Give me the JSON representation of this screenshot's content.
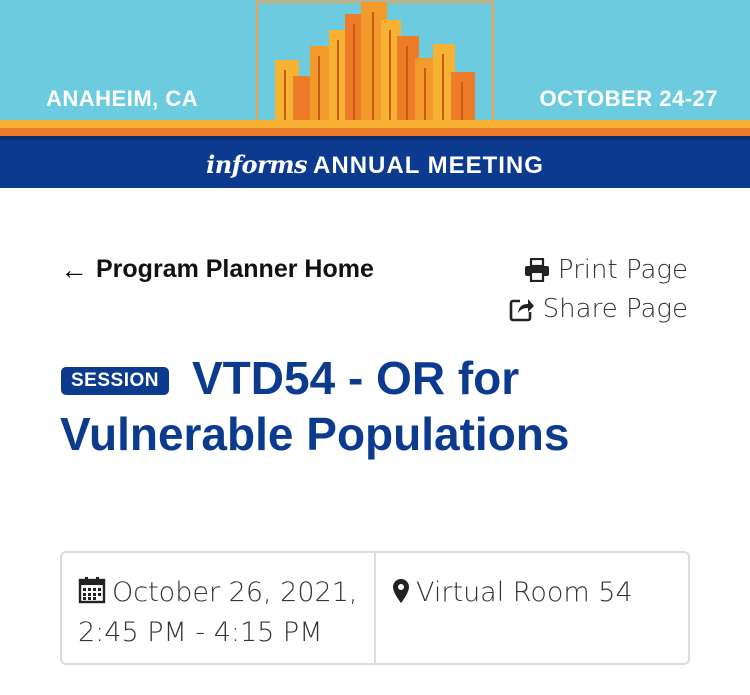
{
  "banner": {
    "location": "ANAHEIM, CA",
    "dates": "OCTOBER 24-27",
    "brand_logo": "informs",
    "brand_title": "ANNUAL MEETING"
  },
  "nav": {
    "back_label": "Program Planner Home",
    "print_label": "Print Page",
    "share_label": "Share Page"
  },
  "session": {
    "badge": "SESSION",
    "title": "VTD54 - OR for Vulnerable Populations",
    "date_line1": "October 26, 2021,",
    "date_line2": "2:45 PM - 4:15 PM",
    "room": "Virtual Room 54"
  },
  "colors": {
    "navy": "#0b3a8f",
    "sky": "#6ccbdf",
    "orange": "#ee7b27",
    "yellow": "#f7b233"
  },
  "icons": {
    "back": "arrow-left-icon",
    "print": "printer-icon",
    "share": "share-icon",
    "calendar": "calendar-icon",
    "location": "map-pin-icon"
  }
}
